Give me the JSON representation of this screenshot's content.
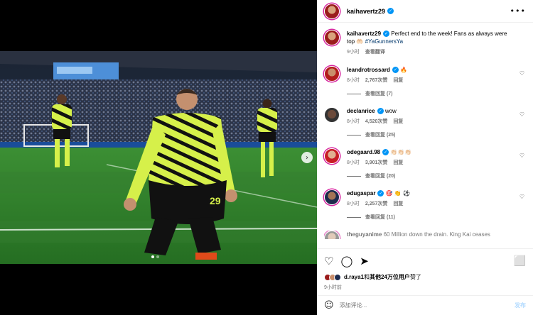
{
  "post": {
    "username": "kaihavertz29",
    "more_icon": "more-horizontal-icon"
  },
  "caption": {
    "username": "kaihavertz29",
    "text": "Perfect end to the week! Fans as always were top",
    "emoji": "🤲🏻",
    "hashtag": "#YaGunnersYa",
    "time": "9小时",
    "translate": "查看翻译"
  },
  "comments": [
    {
      "username": "leandrotrossard",
      "text": "🔥",
      "time": "8小时",
      "likes": "2,767次赞",
      "reply": "回复",
      "view_replies": "查看回复 (7)"
    },
    {
      "username": "declanrice",
      "text": "wow",
      "time": "8小时",
      "likes": "4,520次赞",
      "reply": "回复",
      "view_replies": "查看回复 (25)"
    },
    {
      "username": "odegaard.98",
      "text": "👏🏻👏🏻👏🏻",
      "time": "8小时",
      "likes": "3,901次赞",
      "reply": "回复",
      "view_replies": "查看回复 (20)"
    },
    {
      "username": "edugaspar",
      "text": "🎯 👏 ⚽",
      "time": "8小时",
      "likes": "2,257次赞",
      "reply": "回复",
      "view_replies": "查看回复 (11)"
    }
  ],
  "partial_comment": {
    "username": "theguyanime",
    "text": "60 Million down the drain. King Kai ceases"
  },
  "likes_line": {
    "user": "d.raya1",
    "connector": "和",
    "others": "其他24万位用户",
    "suffix": "赞了"
  },
  "post_time": "9小时前",
  "composer": {
    "placeholder": "添加评论...",
    "post_label": "发布"
  },
  "colors": {
    "verified": "#0095f6",
    "link": "#00376b",
    "muted": "#737373",
    "jersey": "#d6f04a",
    "pitch": "#2f8a2f"
  }
}
